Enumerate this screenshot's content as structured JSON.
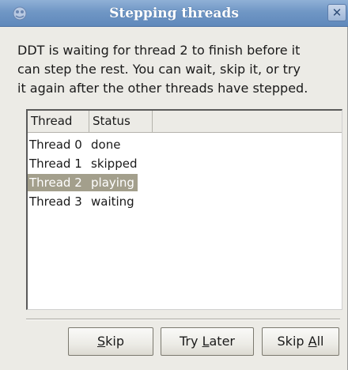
{
  "window": {
    "title": "Stepping threads",
    "close_label": "✕"
  },
  "message": "DDT is waiting for thread 2 to finish before it\ncan step the rest. You can wait, skip it, or try\nit again after the other threads have stepped.",
  "table": {
    "columns": [
      "Thread",
      "Status"
    ],
    "rows": [
      {
        "thread": "Thread 0",
        "status": "done"
      },
      {
        "thread": "Thread 1",
        "status": "skipped"
      },
      {
        "thread": "Thread 2",
        "status": "playing"
      },
      {
        "thread": "Thread 3",
        "status": "waiting"
      }
    ],
    "selected_row": 2
  },
  "buttons": {
    "skip": {
      "mnemonic": "S",
      "rest": "kip"
    },
    "try_later": {
      "prefix": "Try ",
      "mnemonic": "L",
      "rest": "ater"
    },
    "skip_all": {
      "prefix": "Skip ",
      "mnemonic": "A",
      "rest": "ll"
    }
  },
  "colors": {
    "titlebar": "#7097c5",
    "selection": "#a39f8c",
    "window_bg": "#ecebe6"
  },
  "icons": {
    "app_icon": "ddt-app-icon",
    "close_icon": "close-icon"
  }
}
